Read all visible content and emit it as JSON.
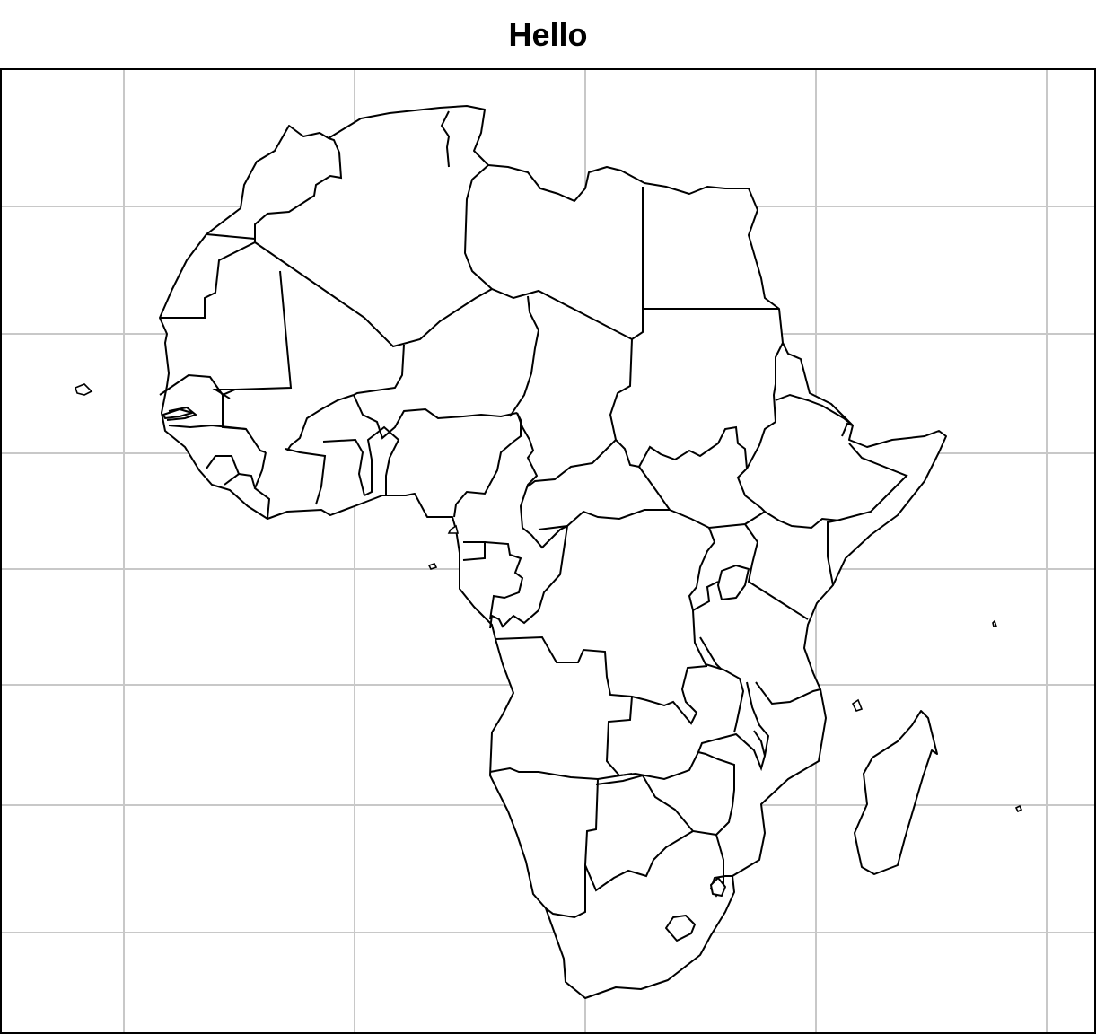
{
  "map": {
    "title": "Hello",
    "region": "Africa",
    "projection": "rectangular",
    "graticule": true,
    "colors": {
      "land": "#ffffff",
      "outline": "#000000",
      "graticule": "#c8c8c8",
      "frame": "#000000",
      "background": "#ffffff"
    }
  }
}
